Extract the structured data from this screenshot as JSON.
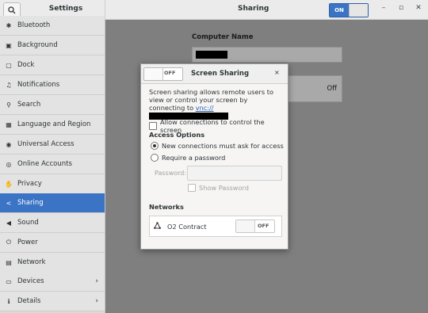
{
  "window": {
    "settings_title": "Settings",
    "page_title": "Sharing",
    "master_switch": "ON",
    "controls": [
      "–",
      "▫",
      "✕"
    ]
  },
  "sidebar": {
    "items": [
      {
        "icon": "bluetooth-icon",
        "glyph": "✱",
        "label": "Bluetooth"
      },
      {
        "icon": "background-icon",
        "glyph": "▣",
        "label": "Background"
      },
      {
        "icon": "dock-icon",
        "glyph": "▢",
        "label": "Dock"
      },
      {
        "icon": "bell-icon",
        "glyph": "♫",
        "label": "Notifications"
      },
      {
        "icon": "search-icon",
        "glyph": "⚲",
        "label": "Search"
      },
      {
        "icon": "language-icon",
        "glyph": "▦",
        "label": "Language and Region"
      },
      {
        "icon": "accessibility-icon",
        "glyph": "◉",
        "label": "Universal Access"
      },
      {
        "icon": "online-accounts-icon",
        "glyph": "◎",
        "label": "Online Accounts"
      },
      {
        "icon": "hand-icon",
        "glyph": "✋",
        "label": "Privacy"
      },
      {
        "icon": "share-icon",
        "glyph": "<",
        "label": "Sharing",
        "active": true
      },
      {
        "icon": "speaker-icon",
        "glyph": "◀",
        "label": "Sound"
      },
      {
        "icon": "power-icon",
        "glyph": "⏻",
        "label": "Power"
      },
      {
        "icon": "network-icon",
        "glyph": "▤",
        "label": "Network"
      },
      {
        "icon": "devices-icon",
        "glyph": "▭",
        "label": "Devices",
        "chevron": true
      },
      {
        "icon": "details-icon",
        "glyph": "ℹ",
        "label": "Details",
        "chevron": true
      }
    ]
  },
  "main": {
    "computer_name_label": "Computer Name",
    "row_status": "Off"
  },
  "dialog": {
    "switch_label": "OFF",
    "title": "Screen Sharing",
    "close": "×",
    "description": "Screen sharing allows remote users to view or control your screen by connecting to ",
    "vnc_link": "vnc://",
    "allow_control": "Allow connections to control the screen",
    "access_options_heading": "Access Options",
    "radio_must_ask": "New connections must ask for access",
    "radio_require_password": "Require a password",
    "password_label": "Password:",
    "show_password": "Show Password",
    "networks_heading": "Networks",
    "network_name": "O2 Contract",
    "network_switch": "OFF"
  }
}
